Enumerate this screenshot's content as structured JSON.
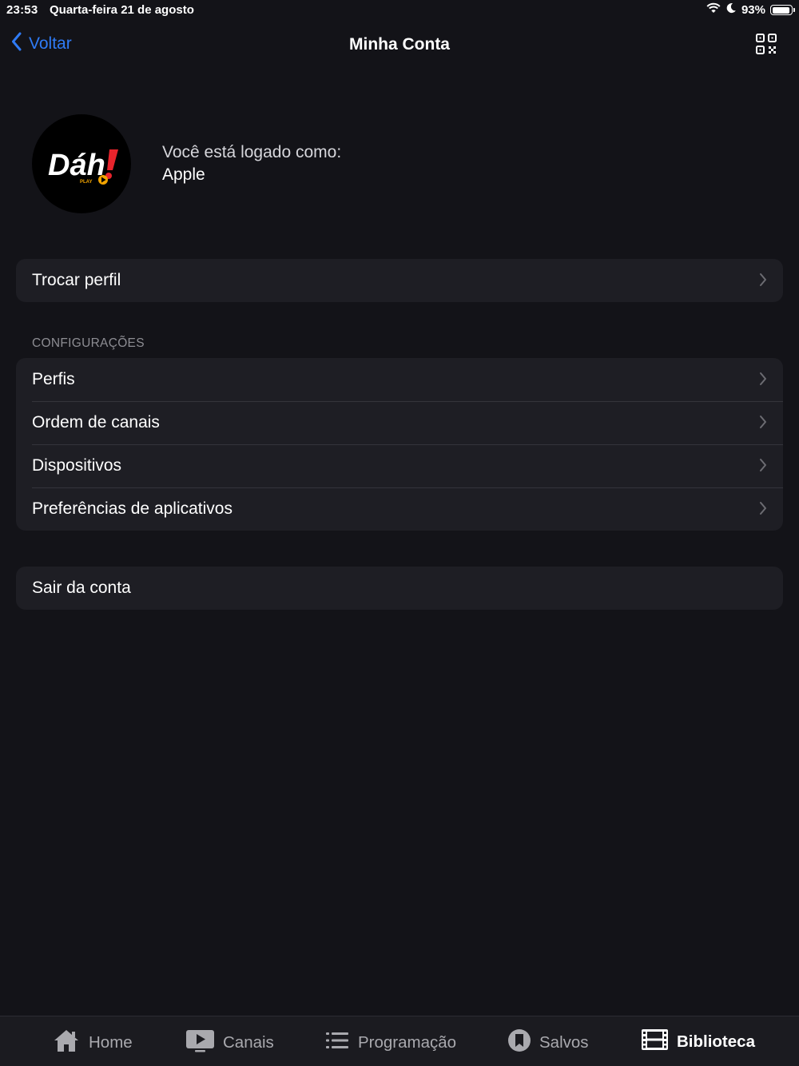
{
  "status_bar": {
    "time": "23:53",
    "date": "Quarta-feira 21 de agosto",
    "battery_percent": "93%",
    "battery_level": 0.93,
    "icons": [
      "wifi-icon",
      "moon-icon",
      "battery-icon"
    ]
  },
  "nav": {
    "back_label": "Voltar",
    "title": "Minha Conta",
    "accent_color": "#2f7bf5",
    "right_icon": "qr-code-icon"
  },
  "profile": {
    "logo_text": "Dáh",
    "logo_subtext": "PLAY",
    "logged_label": "Você está logado como:",
    "username": "Apple"
  },
  "switch_profile": {
    "label": "Trocar perfil"
  },
  "settings": {
    "header": "CONFIGURAÇÕES",
    "items": [
      {
        "label": "Perfis"
      },
      {
        "label": "Ordem de canais"
      },
      {
        "label": "Dispositivos"
      },
      {
        "label": "Preferências de aplicativos"
      }
    ]
  },
  "logout": {
    "label": "Sair da conta"
  },
  "tab_bar": {
    "active": "Biblioteca",
    "tabs": [
      {
        "label": "Home",
        "icon": "home-icon"
      },
      {
        "label": "Canais",
        "icon": "play-screen-icon"
      },
      {
        "label": "Programação",
        "icon": "list-icon"
      },
      {
        "label": "Salvos",
        "icon": "bookmark-icon"
      },
      {
        "label": "Biblioteca",
        "icon": "film-icon"
      }
    ]
  }
}
